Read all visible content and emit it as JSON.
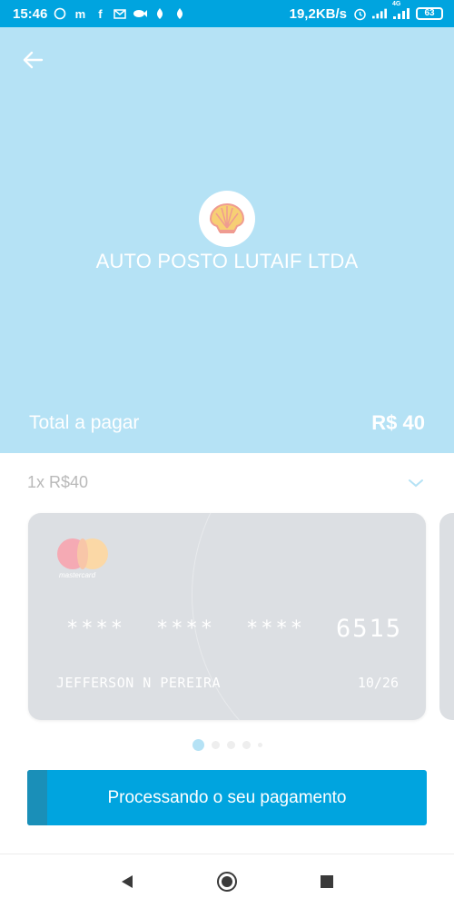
{
  "status_bar": {
    "time": "15:46",
    "net_speed": "19,2KB/s",
    "network": "4G",
    "battery": "63"
  },
  "header": {
    "merchant_name": "AUTO POSTO LUTAIF LTDA",
    "total_label": "Total a pagar",
    "total_value": "R$ 40"
  },
  "installments": {
    "selected": "1x R$40"
  },
  "card": {
    "brand_text": "mastercard",
    "number_masked": [
      "****",
      "****",
      "****"
    ],
    "last_digits": "6515",
    "holder": "JEFFERSON N PEREIRA",
    "expiry": "10/26"
  },
  "pager": {
    "count": 5,
    "active_index": 0
  },
  "button": {
    "label": "Processando o seu pagamento",
    "progress": 0.05
  },
  "colors": {
    "status_bar": "#00a4df",
    "header_bg": "#b5e2f5",
    "button": "#00a4df"
  }
}
